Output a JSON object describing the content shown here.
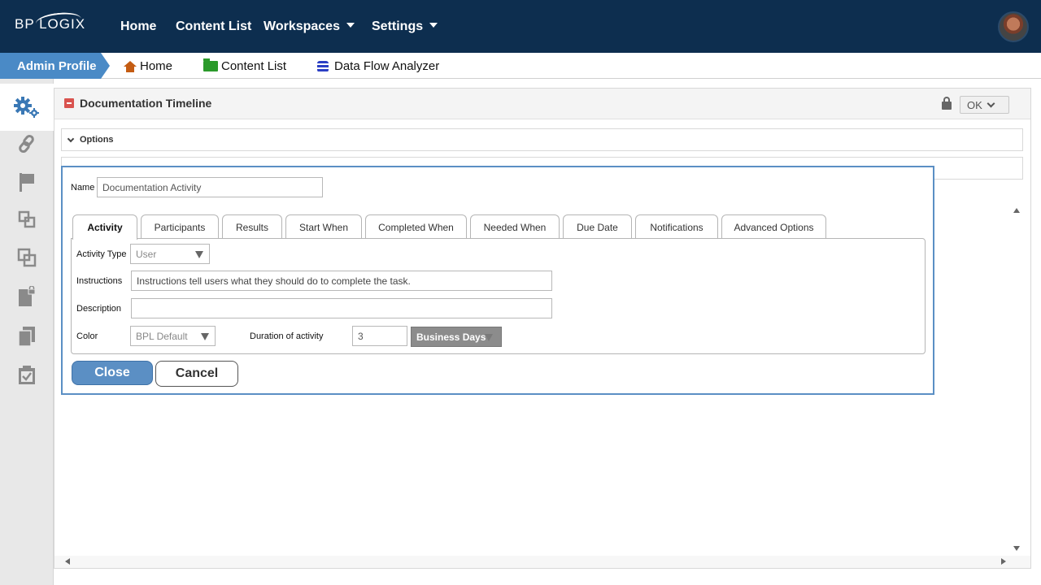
{
  "header": {
    "logo": "BP LOGIX",
    "nav": [
      {
        "label": "Home"
      },
      {
        "label": "Content List"
      },
      {
        "label": "Workspaces"
      },
      {
        "label": "Settings"
      }
    ]
  },
  "subbar": {
    "profile_label": "Admin Profile",
    "crumbs": [
      {
        "label": "Home",
        "icon": "home-icon"
      },
      {
        "label": "Content List",
        "icon": "folder-icon"
      },
      {
        "label": "Data Flow Analyzer",
        "icon": "database-icon"
      }
    ]
  },
  "sidebar": {
    "items": [
      {
        "icon": "gears-icon"
      },
      {
        "icon": "link-icon"
      },
      {
        "icon": "flag-icon"
      },
      {
        "icon": "nested-squares-icon"
      },
      {
        "icon": "overlap-squares-icon"
      },
      {
        "icon": "locked-document-icon"
      },
      {
        "icon": "copy-icon"
      },
      {
        "icon": "checkbox-icon"
      }
    ]
  },
  "panel": {
    "title": "Documentation Timeline",
    "ok_label": "OK",
    "options_label": "Options"
  },
  "dialog": {
    "name_label": "Name",
    "name_value": "Documentation Activity",
    "tabs": [
      {
        "label": "Activity"
      },
      {
        "label": "Participants"
      },
      {
        "label": "Results"
      },
      {
        "label": "Start When"
      },
      {
        "label": "Completed When"
      },
      {
        "label": "Needed When"
      },
      {
        "label": "Due Date"
      },
      {
        "label": "Notifications"
      },
      {
        "label": "Advanced Options"
      }
    ],
    "activity_type_label": "Activity Type",
    "activity_type_value": "User",
    "instructions_label": "Instructions",
    "instructions_value": "Instructions tell users what they should do to complete the task.",
    "description_label": "Description",
    "description_value": "",
    "color_label": "Color",
    "color_value": "BPL Default",
    "duration_label": "Duration of activity",
    "duration_value": "3",
    "duration_unit": "Business Days",
    "close_label": "Close",
    "cancel_label": "Cancel"
  },
  "colors": {
    "topbar": "#0d2e4f",
    "accent": "#4a8ac6",
    "button": "#5b8fc4"
  }
}
